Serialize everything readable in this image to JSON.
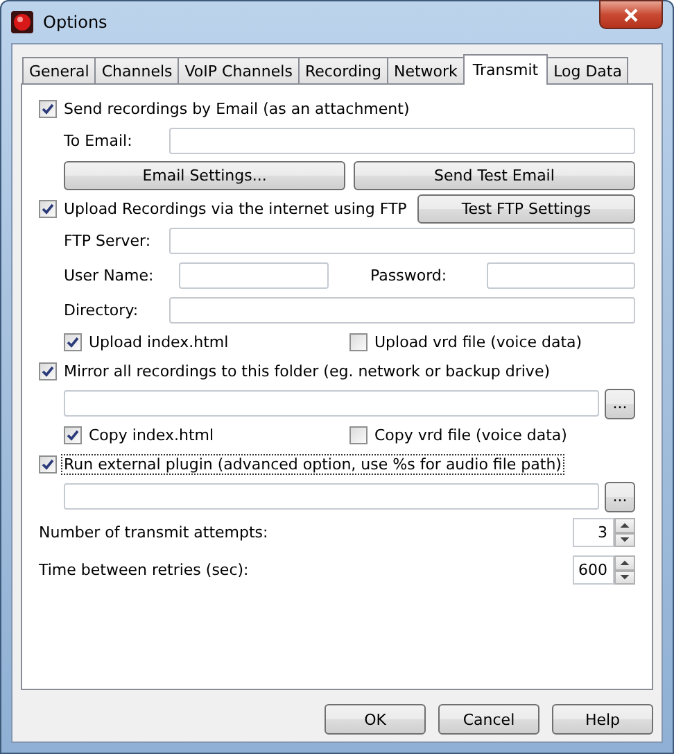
{
  "window": {
    "title": "Options"
  },
  "tabs": [
    {
      "label": "General",
      "selected": false
    },
    {
      "label": "Channels",
      "selected": false
    },
    {
      "label": "VoIP Channels",
      "selected": false
    },
    {
      "label": "Recording",
      "selected": false
    },
    {
      "label": "Network",
      "selected": false
    },
    {
      "label": "Transmit",
      "selected": true
    },
    {
      "label": "Log Data",
      "selected": false
    }
  ],
  "email": {
    "option": {
      "label": "Send recordings by Email (as an attachment)",
      "checked": true,
      "focused": false
    },
    "to_email": {
      "label": "To Email:"
    },
    "buttons": [
      "Email Settings...",
      "Send Test Email"
    ]
  },
  "ftp": {
    "option": {
      "label": "Upload Recordings via the internet using  FTP",
      "checked": true,
      "focused": false
    },
    "test_button": "Test FTP Settings",
    "server": {
      "label": "FTP Server:"
    },
    "user_name": {
      "label": "User Name:"
    },
    "password": {
      "label": "Password:"
    },
    "directory": {
      "label": "Directory:"
    },
    "options": [
      {
        "label": "Upload index.html",
        "checked": true
      },
      {
        "label": "Upload vrd file (voice data)",
        "checked": false
      }
    ]
  },
  "mirror": {
    "option": {
      "label": "Mirror all recordings to this folder (eg. network or backup drive)",
      "checked": true,
      "focused": false
    },
    "browse_button": "...",
    "options": [
      {
        "label": "Copy index.html",
        "checked": true
      },
      {
        "label": "Copy vrd file (voice data)",
        "checked": false
      }
    ]
  },
  "plugin": {
    "option": {
      "label": "Run external plugin (advanced option, use %s for audio file path)",
      "checked": true,
      "focused": true
    },
    "browse_button": "..."
  },
  "spinners": [
    {
      "label": "Number of transmit attempts:",
      "value": "3"
    },
    {
      "label": "Time between retries (sec):",
      "value": "600"
    }
  ],
  "buttons": [
    "OK",
    "Cancel",
    "Help"
  ]
}
